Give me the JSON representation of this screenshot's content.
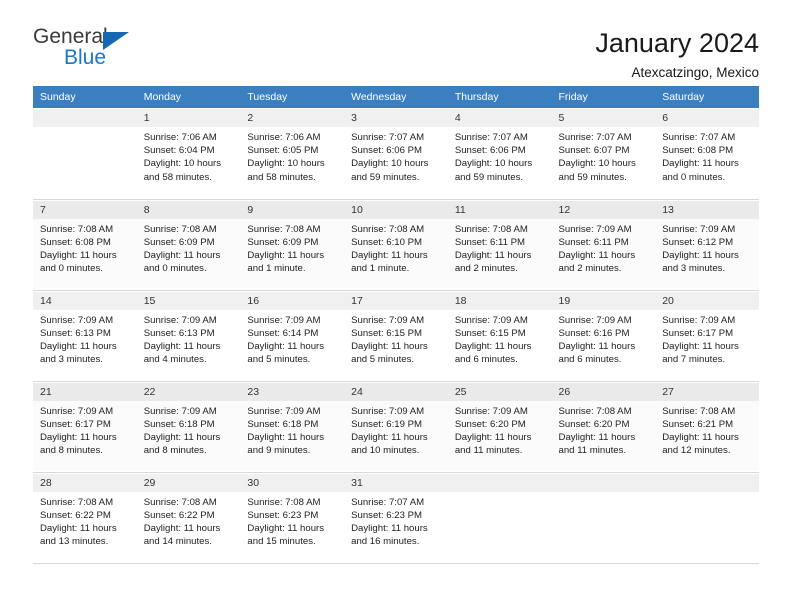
{
  "brand": {
    "name_part1": "General",
    "name_part2": "Blue",
    "triangle_color": "#1668b3",
    "blue_color": "#1b77c9"
  },
  "header": {
    "title": "January 2024",
    "subtitle": "Atexcatzingo, Mexico"
  },
  "theme": {
    "header_row_bg": "#3c7fc1",
    "header_row_text": "#ffffff",
    "daynum_bg": "#f0f0f0"
  },
  "weekdays": [
    "Sunday",
    "Monday",
    "Tuesday",
    "Wednesday",
    "Thursday",
    "Friday",
    "Saturday"
  ],
  "labels": {
    "sunrise_prefix": "Sunrise:",
    "sunset_prefix": "Sunset:",
    "daylight_prefix": "Daylight:"
  },
  "weeks": [
    [
      {
        "day": "",
        "l1": "",
        "l2": "",
        "l3": "",
        "l4": ""
      },
      {
        "day": "1",
        "l1": "Sunrise: 7:06 AM",
        "l2": "Sunset: 6:04 PM",
        "l3": "Daylight: 10 hours",
        "l4": "and 58 minutes."
      },
      {
        "day": "2",
        "l1": "Sunrise: 7:06 AM",
        "l2": "Sunset: 6:05 PM",
        "l3": "Daylight: 10 hours",
        "l4": "and 58 minutes."
      },
      {
        "day": "3",
        "l1": "Sunrise: 7:07 AM",
        "l2": "Sunset: 6:06 PM",
        "l3": "Daylight: 10 hours",
        "l4": "and 59 minutes."
      },
      {
        "day": "4",
        "l1": "Sunrise: 7:07 AM",
        "l2": "Sunset: 6:06 PM",
        "l3": "Daylight: 10 hours",
        "l4": "and 59 minutes."
      },
      {
        "day": "5",
        "l1": "Sunrise: 7:07 AM",
        "l2": "Sunset: 6:07 PM",
        "l3": "Daylight: 10 hours",
        "l4": "and 59 minutes."
      },
      {
        "day": "6",
        "l1": "Sunrise: 7:07 AM",
        "l2": "Sunset: 6:08 PM",
        "l3": "Daylight: 11 hours",
        "l4": "and 0 minutes."
      }
    ],
    [
      {
        "day": "7",
        "l1": "Sunrise: 7:08 AM",
        "l2": "Sunset: 6:08 PM",
        "l3": "Daylight: 11 hours",
        "l4": "and 0 minutes."
      },
      {
        "day": "8",
        "l1": "Sunrise: 7:08 AM",
        "l2": "Sunset: 6:09 PM",
        "l3": "Daylight: 11 hours",
        "l4": "and 0 minutes."
      },
      {
        "day": "9",
        "l1": "Sunrise: 7:08 AM",
        "l2": "Sunset: 6:09 PM",
        "l3": "Daylight: 11 hours",
        "l4": "and 1 minute."
      },
      {
        "day": "10",
        "l1": "Sunrise: 7:08 AM",
        "l2": "Sunset: 6:10 PM",
        "l3": "Daylight: 11 hours",
        "l4": "and 1 minute."
      },
      {
        "day": "11",
        "l1": "Sunrise: 7:08 AM",
        "l2": "Sunset: 6:11 PM",
        "l3": "Daylight: 11 hours",
        "l4": "and 2 minutes."
      },
      {
        "day": "12",
        "l1": "Sunrise: 7:09 AM",
        "l2": "Sunset: 6:11 PM",
        "l3": "Daylight: 11 hours",
        "l4": "and 2 minutes."
      },
      {
        "day": "13",
        "l1": "Sunrise: 7:09 AM",
        "l2": "Sunset: 6:12 PM",
        "l3": "Daylight: 11 hours",
        "l4": "and 3 minutes."
      }
    ],
    [
      {
        "day": "14",
        "l1": "Sunrise: 7:09 AM",
        "l2": "Sunset: 6:13 PM",
        "l3": "Daylight: 11 hours",
        "l4": "and 3 minutes."
      },
      {
        "day": "15",
        "l1": "Sunrise: 7:09 AM",
        "l2": "Sunset: 6:13 PM",
        "l3": "Daylight: 11 hours",
        "l4": "and 4 minutes."
      },
      {
        "day": "16",
        "l1": "Sunrise: 7:09 AM",
        "l2": "Sunset: 6:14 PM",
        "l3": "Daylight: 11 hours",
        "l4": "and 5 minutes."
      },
      {
        "day": "17",
        "l1": "Sunrise: 7:09 AM",
        "l2": "Sunset: 6:15 PM",
        "l3": "Daylight: 11 hours",
        "l4": "and 5 minutes."
      },
      {
        "day": "18",
        "l1": "Sunrise: 7:09 AM",
        "l2": "Sunset: 6:15 PM",
        "l3": "Daylight: 11 hours",
        "l4": "and 6 minutes."
      },
      {
        "day": "19",
        "l1": "Sunrise: 7:09 AM",
        "l2": "Sunset: 6:16 PM",
        "l3": "Daylight: 11 hours",
        "l4": "and 6 minutes."
      },
      {
        "day": "20",
        "l1": "Sunrise: 7:09 AM",
        "l2": "Sunset: 6:17 PM",
        "l3": "Daylight: 11 hours",
        "l4": "and 7 minutes."
      }
    ],
    [
      {
        "day": "21",
        "l1": "Sunrise: 7:09 AM",
        "l2": "Sunset: 6:17 PM",
        "l3": "Daylight: 11 hours",
        "l4": "and 8 minutes."
      },
      {
        "day": "22",
        "l1": "Sunrise: 7:09 AM",
        "l2": "Sunset: 6:18 PM",
        "l3": "Daylight: 11 hours",
        "l4": "and 8 minutes."
      },
      {
        "day": "23",
        "l1": "Sunrise: 7:09 AM",
        "l2": "Sunset: 6:18 PM",
        "l3": "Daylight: 11 hours",
        "l4": "and 9 minutes."
      },
      {
        "day": "24",
        "l1": "Sunrise: 7:09 AM",
        "l2": "Sunset: 6:19 PM",
        "l3": "Daylight: 11 hours",
        "l4": "and 10 minutes."
      },
      {
        "day": "25",
        "l1": "Sunrise: 7:09 AM",
        "l2": "Sunset: 6:20 PM",
        "l3": "Daylight: 11 hours",
        "l4": "and 11 minutes."
      },
      {
        "day": "26",
        "l1": "Sunrise: 7:08 AM",
        "l2": "Sunset: 6:20 PM",
        "l3": "Daylight: 11 hours",
        "l4": "and 11 minutes."
      },
      {
        "day": "27",
        "l1": "Sunrise: 7:08 AM",
        "l2": "Sunset: 6:21 PM",
        "l3": "Daylight: 11 hours",
        "l4": "and 12 minutes."
      }
    ],
    [
      {
        "day": "28",
        "l1": "Sunrise: 7:08 AM",
        "l2": "Sunset: 6:22 PM",
        "l3": "Daylight: 11 hours",
        "l4": "and 13 minutes."
      },
      {
        "day": "29",
        "l1": "Sunrise: 7:08 AM",
        "l2": "Sunset: 6:22 PM",
        "l3": "Daylight: 11 hours",
        "l4": "and 14 minutes."
      },
      {
        "day": "30",
        "l1": "Sunrise: 7:08 AM",
        "l2": "Sunset: 6:23 PM",
        "l3": "Daylight: 11 hours",
        "l4": "and 15 minutes."
      },
      {
        "day": "31",
        "l1": "Sunrise: 7:07 AM",
        "l2": "Sunset: 6:23 PM",
        "l3": "Daylight: 11 hours",
        "l4": "and 16 minutes."
      },
      {
        "day": "",
        "l1": "",
        "l2": "",
        "l3": "",
        "l4": ""
      },
      {
        "day": "",
        "l1": "",
        "l2": "",
        "l3": "",
        "l4": ""
      },
      {
        "day": "",
        "l1": "",
        "l2": "",
        "l3": "",
        "l4": ""
      }
    ]
  ]
}
